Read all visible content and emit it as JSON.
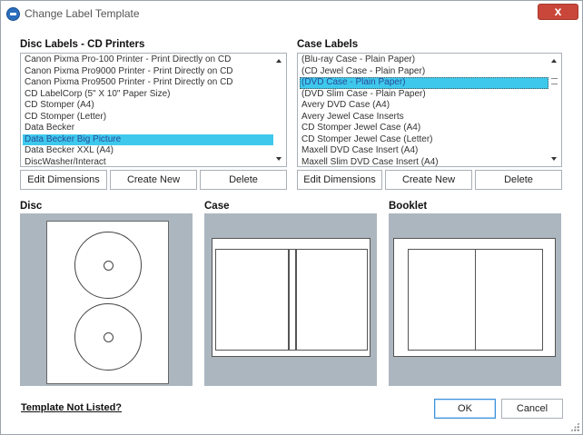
{
  "window": {
    "title": "Change Label Template",
    "close_label": "x"
  },
  "disc_labels": {
    "heading": "Disc Labels - CD Printers",
    "items": [
      "Canon Pixma Pro-100 Printer - Print Directly on CD",
      "Canon Pixma Pro9000 Printer - Print Directly on CD",
      "Canon Pixma Pro9500 Printer - Print Directly on CD",
      "CD LabelCorp (5\" X 10\" Paper Size)",
      "CD Stomper (A4)",
      "CD Stomper (Letter)",
      "Data Becker",
      "Data Becker Big Picture",
      "Data Becker XXL (A4)",
      "DiscWasher/Interact"
    ],
    "selected_index": 7,
    "buttons": {
      "edit": "Edit Dimensions",
      "create": "Create New",
      "delete": "Delete"
    }
  },
  "case_labels": {
    "heading": "Case Labels",
    "items": [
      "(Blu-ray Case - Plain Paper)",
      "(CD Jewel Case - Plain Paper)",
      "(DVD Case - Plain Paper)",
      "(DVD Slim Case - Plain Paper)",
      "Avery DVD Case (A4)",
      "Avery Jewel Case Inserts",
      "CD Stomper Jewel Case (A4)",
      "CD Stomper Jewel Case (Letter)",
      "Maxell DVD Case Insert (A4)",
      "Maxell Slim DVD Case Insert (A4)"
    ],
    "selected_index": 2,
    "buttons": {
      "edit": "Edit Dimensions",
      "create": "Create New",
      "delete": "Delete"
    }
  },
  "previews": {
    "disc": "Disc",
    "case": "Case",
    "booklet": "Booklet"
  },
  "footer": {
    "link": "Template Not Listed?",
    "ok": "OK",
    "cancel": "Cancel"
  },
  "colors": {
    "selection": "#3ec9ec",
    "preview_bg": "#acb6bf"
  }
}
